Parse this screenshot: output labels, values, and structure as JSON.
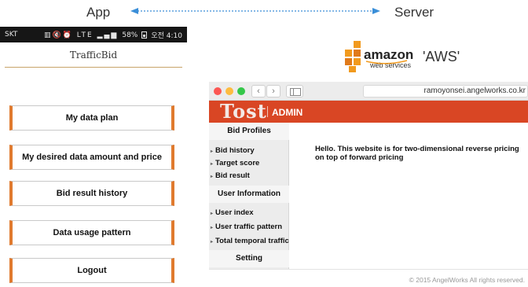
{
  "diagram": {
    "app_label": "App",
    "server_label": "Server",
    "server_caption": "'AWS'"
  },
  "aws_logo": {
    "wordmark": "amazon",
    "sub": "web services"
  },
  "phone": {
    "status": {
      "carrier": "SKT",
      "icons": "▥🔇⏰ LTE ▂▄▆",
      "battery": "58%",
      "time": "오전 4:10"
    },
    "app_title": "TrafficBid",
    "menu": [
      "My data plan",
      "My desired data amount and price",
      "Bid result history",
      "Data usage pattern",
      "Logout"
    ]
  },
  "browser": {
    "back_glyph": "‹",
    "forward_glyph": "›",
    "url": "ramoyonsei.angelworks.co.kr",
    "logo": "Tost",
    "admin": "ADMIN",
    "sidebar": {
      "bid_profiles": "Bid Profiles",
      "bid_items": [
        "Bid history",
        "Target score",
        "Bid result"
      ],
      "user_information": "User Information",
      "user_items": [
        "User index",
        "User traffic pattern",
        "Total temporal traffic"
      ],
      "setting": "Setting"
    },
    "main_text": "Hello. This website is for two-dimensional reverse pricing on top of forward pricing",
    "copyright": "© 2015 AngelWorks All rights reserved."
  },
  "colors": {
    "accent_orange": "#e07a2e",
    "header_red": "#d94624",
    "arrow_blue": "#3a8ed8",
    "aws_orange": "#f19a1e"
  }
}
